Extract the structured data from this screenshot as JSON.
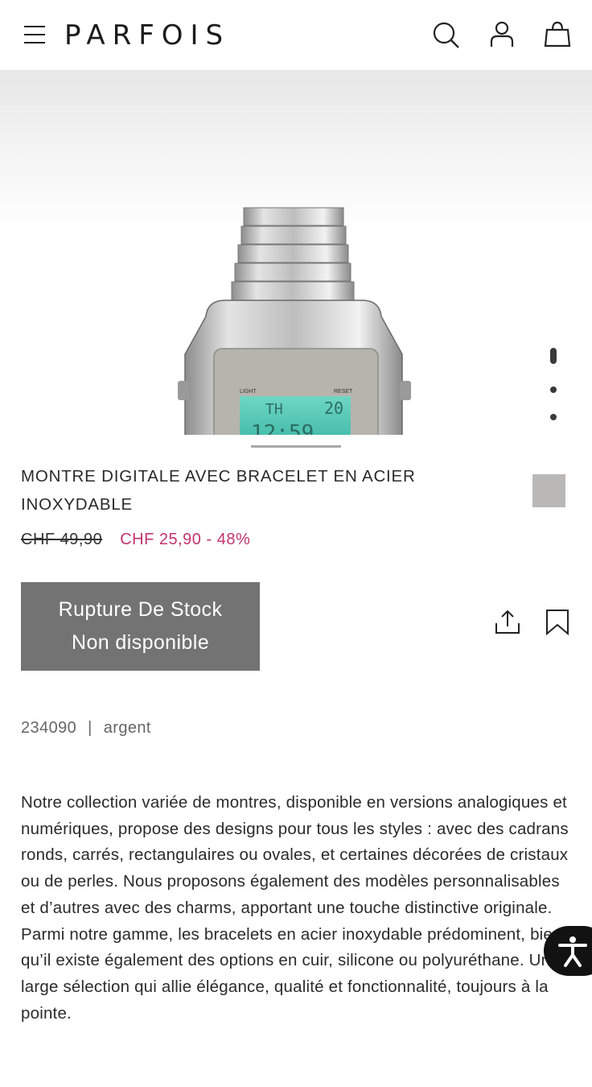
{
  "header": {
    "brand": "PARFOIS",
    "icons": [
      "menu-icon",
      "search-icon",
      "account-icon",
      "shopping-bag-icon"
    ]
  },
  "gallery": {
    "image_alt": "Montre digitale argentée",
    "watch_labels": {
      "light": "LIGHT",
      "reset": "RESET",
      "day": "TH",
      "date": "20"
    },
    "slide_count": 3,
    "active_slide": 1
  },
  "product": {
    "title": "MONTRE DIGITALE AVEC BRACELET EN ACIER INOXYDABLE",
    "old_price": "CHF 49,90",
    "new_price": "CHF 25,90 - 48%",
    "swatch_color": "#b9b8b6",
    "stock_button": {
      "line1": "Rupture De Stock",
      "line2": "Non disponible"
    },
    "reference": "234090",
    "separator": "|",
    "color_name": "argent",
    "description": "Notre collection variée de montres, disponible en versions analogiques et numériques, propose des designs pour tous les styles : avec des cadrans ronds, carrés, rectangulaires ou ovales, et certaines décorées de cristaux ou de perles. Nous proposons également des modèles personnalisables et d’autres avec des charms, apportant une touche distinctive originale. Parmi notre gamme, les bracelets en acier inoxydable prédominent, bien qu’il existe également des options en cuir, silicone ou polyuréthane. Une large sélection qui allie élégance, qualité et fonctionnalité, toujours à la pointe."
  },
  "colors": {
    "sale": "#c2356b",
    "button_bg": "#737373",
    "accessibility_bg": "#121212"
  }
}
